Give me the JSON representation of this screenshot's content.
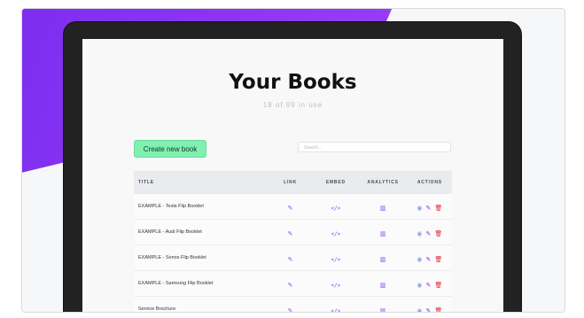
{
  "page": {
    "title": "Your Books",
    "usage": "18 of 99 in use"
  },
  "toolbar": {
    "create_label": "Create new book",
    "search_placeholder": "Search..."
  },
  "table": {
    "headers": [
      "TITLE",
      "LINK",
      "EMBED",
      "ANALYTICS",
      "ACTIONS"
    ],
    "rows": [
      {
        "title": "EXAMPLE - Tesla Flip Booklet"
      },
      {
        "title": "EXAMPLE - Audi Flip Booklet"
      },
      {
        "title": "EXAMPLE - Sonos Flip Booklet"
      },
      {
        "title": "EXAMPLE - Samsung Flip Booklet"
      },
      {
        "title": "Service Brochure"
      }
    ]
  },
  "icons": {
    "link": "pin-icon",
    "embed": "code-icon",
    "analytics": "chart-icon",
    "view": "eye-icon",
    "edit": "pencil-icon",
    "delete": "trash-icon"
  },
  "colors": {
    "accent": "#8a3ff2",
    "button": "#7ff0b0",
    "delete": "#e6232f"
  }
}
